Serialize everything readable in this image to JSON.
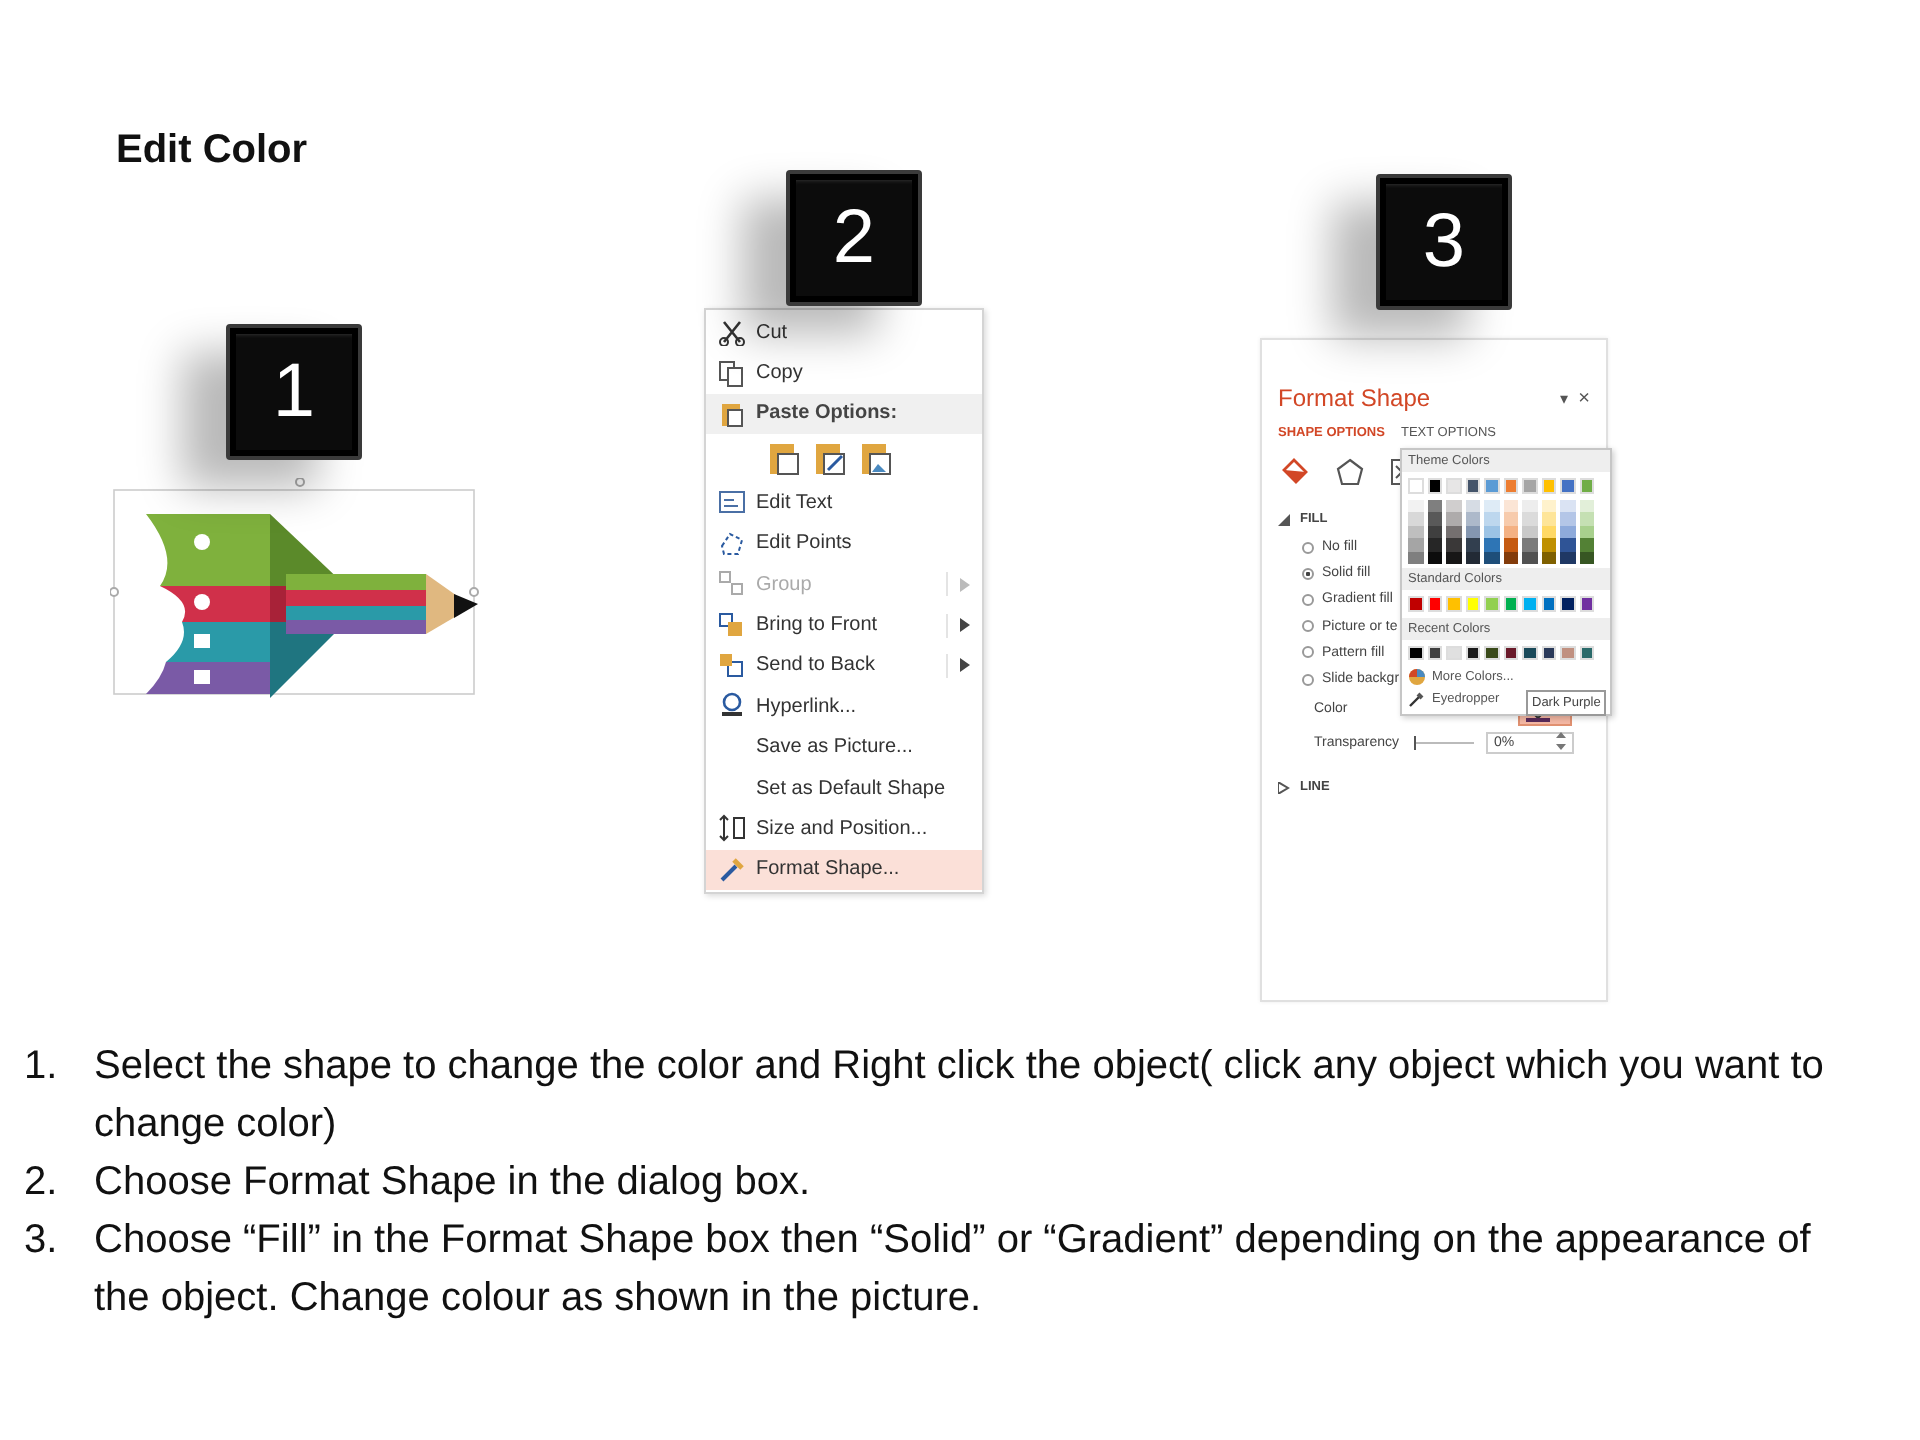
{
  "title": "Edit Color",
  "steps": [
    {
      "number": "1"
    },
    {
      "number": "2"
    },
    {
      "number": "3"
    }
  ],
  "context_menu": {
    "items": [
      {
        "kind": "item",
        "label": "Cut",
        "disabled": false,
        "submenu": false,
        "selected": false
      },
      {
        "kind": "item",
        "label": "Copy",
        "disabled": false,
        "submenu": false,
        "selected": false
      },
      {
        "kind": "header",
        "label": "Paste Options:"
      },
      {
        "kind": "paste"
      },
      {
        "kind": "item",
        "label": "Edit Text",
        "disabled": false,
        "submenu": false,
        "selected": false
      },
      {
        "kind": "item",
        "label": "Edit Points",
        "disabled": false,
        "submenu": false,
        "selected": false
      },
      {
        "kind": "item",
        "label": "Group",
        "disabled": true,
        "submenu": true,
        "selected": false
      },
      {
        "kind": "item",
        "label": "Bring to Front",
        "disabled": false,
        "submenu": true,
        "selected": false
      },
      {
        "kind": "item",
        "label": "Send to Back",
        "disabled": false,
        "submenu": true,
        "selected": false
      },
      {
        "kind": "item",
        "label": "Hyperlink...",
        "disabled": false,
        "submenu": false,
        "selected": false
      },
      {
        "kind": "item",
        "label": "Save as Picture...",
        "disabled": false,
        "submenu": false,
        "selected": false
      },
      {
        "kind": "item",
        "label": "Set as Default Shape",
        "disabled": false,
        "submenu": false,
        "selected": false
      },
      {
        "kind": "item",
        "label": "Size and Position...",
        "disabled": false,
        "submenu": false,
        "selected": false
      },
      {
        "kind": "item",
        "label": "Format Shape...",
        "disabled": false,
        "submenu": false,
        "selected": true
      }
    ]
  },
  "format_shape": {
    "title": "Format Shape",
    "pin": "▾",
    "close": "×",
    "tabs": [
      {
        "label": "SHAPE OPTIONS",
        "selected": true
      },
      {
        "label": "TEXT OPTIONS",
        "selected": false
      }
    ],
    "fill_section": {
      "label": "FILL",
      "expanded": true,
      "options": [
        {
          "label": "No fill",
          "selected": false
        },
        {
          "label": "Solid fill",
          "selected": true
        },
        {
          "label": "Gradient fill",
          "selected": false
        },
        {
          "label": "Picture or te",
          "selected": false
        },
        {
          "label": "Pattern fill",
          "selected": false
        },
        {
          "label": "Slide backgr",
          "selected": false
        }
      ],
      "color_label": "Color",
      "transparency_label": "Transparency",
      "transparency": {
        "level": 0
      },
      "transparency_value": "0%"
    },
    "line_section": {
      "label": "LINE",
      "expanded": false
    },
    "color_picker": {
      "theme_heading": "Theme Colors",
      "theme": [
        {
          "color": "#ffffff"
        },
        {
          "color": "#000000"
        },
        {
          "color": "#e7e6e6"
        },
        {
          "color": "#44546a"
        },
        {
          "color": "#5b9bd5"
        },
        {
          "color": "#ed7d31"
        },
        {
          "color": "#a5a5a5"
        },
        {
          "color": "#ffc000"
        },
        {
          "color": "#4472c4"
        },
        {
          "color": "#70ad47"
        }
      ],
      "shades": [
        [
          {
            "color": "#f2f2f2"
          },
          {
            "color": "#7f7f7f"
          },
          {
            "color": "#d0cece"
          },
          {
            "color": "#d6dce4"
          },
          {
            "color": "#deebf6"
          },
          {
            "color": "#fbe5d5"
          },
          {
            "color": "#ededed"
          },
          {
            "color": "#fff2cc"
          },
          {
            "color": "#dae3f3"
          },
          {
            "color": "#e2efd9"
          }
        ],
        [
          {
            "color": "#d8d8d8"
          },
          {
            "color": "#595959"
          },
          {
            "color": "#aeabab"
          },
          {
            "color": "#adb9ca"
          },
          {
            "color": "#bdd7ee"
          },
          {
            "color": "#f7cbac"
          },
          {
            "color": "#dbdbdb"
          },
          {
            "color": "#fee599"
          },
          {
            "color": "#b4c6e7"
          },
          {
            "color": "#c5e0b3"
          }
        ],
        [
          {
            "color": "#bfbfbf"
          },
          {
            "color": "#3f3f3f"
          },
          {
            "color": "#757070"
          },
          {
            "color": "#8496b0"
          },
          {
            "color": "#9cc3e5"
          },
          {
            "color": "#f4b183"
          },
          {
            "color": "#c9c9c9"
          },
          {
            "color": "#ffd965"
          },
          {
            "color": "#8eaadb"
          },
          {
            "color": "#a8d08d"
          }
        ],
        [
          {
            "color": "#a5a5a5"
          },
          {
            "color": "#262626"
          },
          {
            "color": "#3a3838"
          },
          {
            "color": "#323f4f"
          },
          {
            "color": "#2e75b5"
          },
          {
            "color": "#c55a11"
          },
          {
            "color": "#7b7b7b"
          },
          {
            "color": "#bf9000"
          },
          {
            "color": "#2f5496"
          },
          {
            "color": "#538135"
          }
        ],
        [
          {
            "color": "#7f7f7f"
          },
          {
            "color": "#0c0c0c"
          },
          {
            "color": "#171616"
          },
          {
            "color": "#222a35"
          },
          {
            "color": "#1e4e79"
          },
          {
            "color": "#833c0b"
          },
          {
            "color": "#525252"
          },
          {
            "color": "#7f6000"
          },
          {
            "color": "#1f3864"
          },
          {
            "color": "#375623"
          }
        ]
      ],
      "standard_heading": "Standard Colors",
      "standard": [
        {
          "color": "#c00000"
        },
        {
          "color": "#ff0000"
        },
        {
          "color": "#ffc000"
        },
        {
          "color": "#ffff00"
        },
        {
          "color": "#92d050"
        },
        {
          "color": "#00b050"
        },
        {
          "color": "#00b0f0"
        },
        {
          "color": "#0070c0"
        },
        {
          "color": "#002060"
        },
        {
          "color": "#7030a0"
        }
      ],
      "recent_heading": "Recent Colors",
      "recent": [
        {
          "color": "#000000"
        },
        {
          "color": "#404040"
        },
        {
          "color": "#e0e0e0"
        },
        {
          "color": "#1a1a1a"
        },
        {
          "color": "#3a4a1a"
        },
        {
          "color": "#6a1a2a"
        },
        {
          "color": "#1a4a5a"
        },
        {
          "color": "#2a3a5a"
        },
        {
          "color": "#c09080"
        },
        {
          "color": "#2a6a6a"
        }
      ],
      "more_colors": "More Colors...",
      "eyedropper": "Eyedropper",
      "tooltip": "Dark Purple"
    }
  },
  "instructions": [
    {
      "number": "1.",
      "text": "Select the shape to change the color and Right click the object( click any object which you want to change color)"
    },
    {
      "number": "2.",
      "text": "Choose Format Shape in the dialog box."
    },
    {
      "number": "3.",
      "text": "Choose “Fill” in the Format Shape box then “Solid” or “Gradient” depending on the appearance of the object. Change colour as shown in the picture."
    }
  ]
}
